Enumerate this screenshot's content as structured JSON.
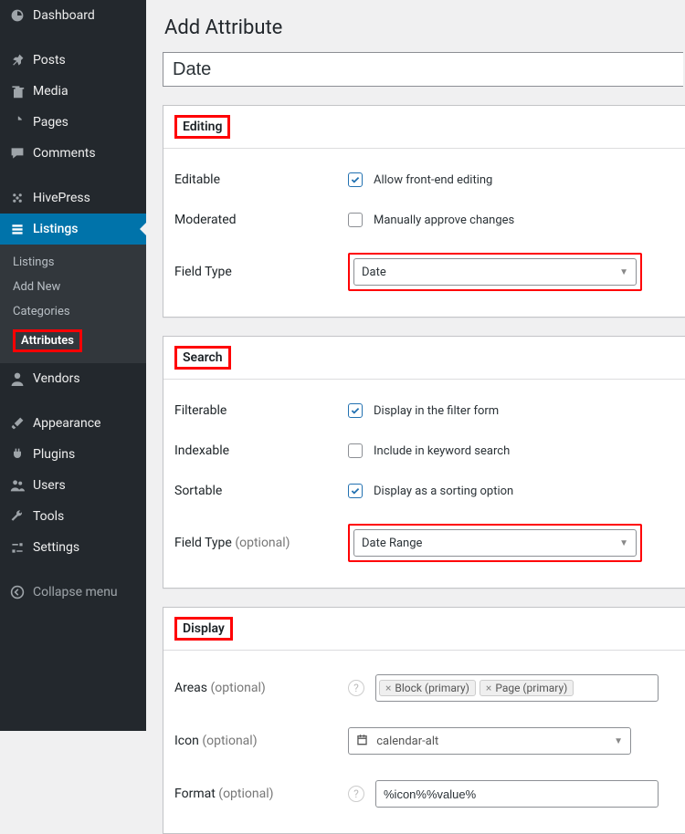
{
  "sidebar": {
    "items": [
      {
        "label": "Dashboard",
        "icon": "dashboard-icon"
      },
      {
        "label": "Posts",
        "icon": "pin-icon"
      },
      {
        "label": "Media",
        "icon": "media-icon"
      },
      {
        "label": "Pages",
        "icon": "page-icon"
      },
      {
        "label": "Comments",
        "icon": "comment-icon"
      },
      {
        "label": "HivePress",
        "icon": "hivepress-icon"
      },
      {
        "label": "Listings",
        "icon": "list-icon"
      }
    ],
    "sub": {
      "listings": "Listings",
      "add_new": "Add New",
      "categories": "Categories",
      "attributes": "Attributes"
    },
    "items2": [
      {
        "label": "Vendors",
        "icon": "user-icon"
      },
      {
        "label": "Appearance",
        "icon": "brush-icon"
      },
      {
        "label": "Plugins",
        "icon": "plug-icon"
      },
      {
        "label": "Users",
        "icon": "users-icon"
      },
      {
        "label": "Tools",
        "icon": "wrench-icon"
      },
      {
        "label": "Settings",
        "icon": "sliders-icon"
      }
    ],
    "collapse": "Collapse menu"
  },
  "page": {
    "title": "Add Attribute",
    "name_value": "Date"
  },
  "editing": {
    "heading": "Editing",
    "editable_label": "Editable",
    "editable_cb_label": "Allow front-end editing",
    "moderated_label": "Moderated",
    "moderated_cb_label": "Manually approve changes",
    "field_type_label": "Field Type",
    "field_type_value": "Date"
  },
  "search": {
    "heading": "Search",
    "filterable_label": "Filterable",
    "filterable_cb_label": "Display in the filter form",
    "indexable_label": "Indexable",
    "indexable_cb_label": "Include in keyword search",
    "sortable_label": "Sortable",
    "sortable_cb_label": "Display as a sorting option",
    "field_type_label": "Field Type",
    "optional": "(optional)",
    "field_type_value": "Date Range"
  },
  "display": {
    "heading": "Display",
    "areas_label": "Areas",
    "areas_tokens": [
      "Block (primary)",
      "Page (primary)"
    ],
    "icon_label": "Icon",
    "icon_value": "calendar-alt",
    "format_label": "Format",
    "format_value": "%icon%%value%",
    "optional": "(optional)"
  }
}
